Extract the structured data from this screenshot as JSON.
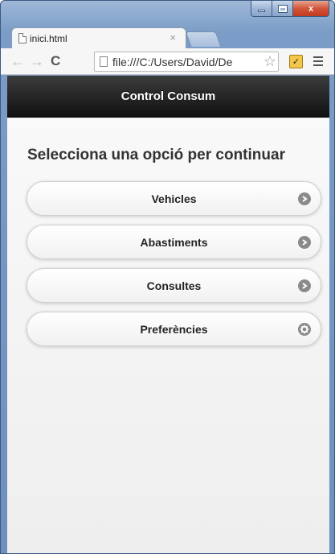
{
  "browser": {
    "tab": {
      "title": "inici.html",
      "close_label": "×"
    },
    "address": {
      "url": "file:///C:/Users/David/De"
    },
    "nav": {
      "back": "←",
      "forward": "→",
      "reload": "C"
    },
    "window_buttons": {
      "close": "x"
    },
    "star_glyph": "☆",
    "extension_glyph": "✓"
  },
  "app": {
    "header_title": "Control Consum",
    "prompt": "Selecciona una opció per continuar",
    "menu": [
      {
        "label": "Vehicles",
        "icon": "arrow-right-icon"
      },
      {
        "label": "Abastiments",
        "icon": "arrow-right-icon"
      },
      {
        "label": "Consultes",
        "icon": "arrow-right-icon"
      },
      {
        "label": "Preferències",
        "icon": "gear-icon"
      }
    ]
  },
  "colors": {
    "header_bg": "#1a1a1a",
    "button_icon": "#8a8a8a",
    "page_bg": "#f1f1f1"
  }
}
